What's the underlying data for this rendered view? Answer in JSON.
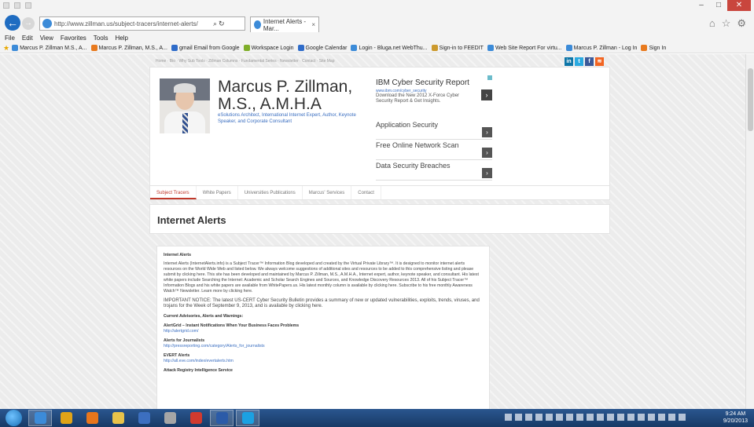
{
  "browser": {
    "url": "http://www.zillman.us/subject-tracers/internet-alerts/",
    "tab_title": "Internet Alerts - Mar...",
    "menu": [
      "File",
      "Edit",
      "View",
      "Favorites",
      "Tools",
      "Help"
    ],
    "favorites": [
      {
        "label": "Marcus P. Zillman M.S., A...",
        "color": "#3c8bd8"
      },
      {
        "label": "Marcus P. Zillman, M.S., A...",
        "color": "#e87a1e"
      },
      {
        "label": "gmail Email from Google",
        "color": "#2f6cc9"
      },
      {
        "label": "Workspace Login",
        "color": "#7fae2a"
      },
      {
        "label": "Google Calendar",
        "color": "#2f6cc9"
      },
      {
        "label": "Login - Bluga.net WebThu...",
        "color": "#3c8bd8"
      },
      {
        "label": "Sign-in to FEEDIT",
        "color": "#cc9a2e"
      },
      {
        "label": "Web Site Report For virtu...",
        "color": "#3c8bd8"
      },
      {
        "label": "Marcus P. Zillman - Log In",
        "color": "#3c8bd8"
      },
      {
        "label": "Sign In",
        "color": "#e87a1e"
      }
    ]
  },
  "site": {
    "topnav": "Home · Bio · Why Sub Tools · Zillman Columns · Fundamental Series · Newsletter · Contact · Site Map",
    "name_line1": "Marcus P. Zillman,",
    "name_line2": "M.S., A.M.H.A",
    "tagline_prefix": "eSolutions Architect, International Internet Expert, Author, Keynote Speaker, and Corporate Consultant",
    "ad": {
      "title": "IBM Cyber Security Report",
      "url": "www.ibm.com/cyber_security",
      "desc": "Download the New 2012 X-Force Cyber Security Report & Get Insights."
    },
    "ad_links": [
      "Application Security",
      "Free Online Network Scan",
      "Data Security Breaches"
    ],
    "subnav": [
      "Subject Tracers",
      "White Papers",
      "Universities Publications",
      "Marcus' Services",
      "Contact"
    ],
    "page_title": "Internet Alerts",
    "content": {
      "heading": "Internet Alerts",
      "intro": "Internet Alerts (InternetAlerts.info) is a Subject Tracer™ Information Blog developed and created by the Virtual Private Library™. It is designed to monitor internet alerts resources on the World Wide Web and listed below. We always welcome suggestions of additional sites and resources to be added to this comprehensive listing and please submit by clicking here. This site has been developed and maintained by Marcus P. Zillman, M.S., A.M.H.A., Internet expert, author, keynote speaker, and consultant. His latest white papers include Searching the Internet: Academic and Scholar Search Engines and Sources, and Knowledge Discovery Resources 2013. All of his Subject Tracer™ Information Blogs and his white papers are available from WhitePapers.us. His latest monthly column is available by clicking here. Subscribe to his free monthly Awareness Watch™ Newsletter. Learn more by clicking here.",
      "notice": "IMPORTANT NOTICE: The latest US-CERT Cyber Security Bulletin provides a summary of new or updated vulnerabilities, exploits, trends, viruses, and trojans for the Week of September 9, 2013, and is available by clicking here.",
      "section": "Current Advisories, Alerts and Warnings:",
      "items": [
        {
          "title": "AlertGrid – Instant Notifications When Your Business Faces Problems",
          "link": "http://alertgrid.com/"
        },
        {
          "title": "Alerts for Journalists",
          "link": "http://pressreporting.com/category/Alerts_for_journalists"
        },
        {
          "title": "EVERT Alerts",
          "link": "http://all.eve.com/index/evertalerts.htm"
        },
        {
          "title": "Attack Registry Intelligence Service",
          "link": ""
        }
      ]
    }
  },
  "taskbar": {
    "time": "9:24 AM",
    "date": "9/20/2013",
    "apps": [
      {
        "name": "ie",
        "color": "#3c8bd8",
        "active": true
      },
      {
        "name": "chrome",
        "color": "#e0a418",
        "active": false
      },
      {
        "name": "firefox",
        "color": "#e8761c",
        "active": false
      },
      {
        "name": "explorer",
        "color": "#e8c34a",
        "active": false
      },
      {
        "name": "media",
        "color": "#3c6fc0",
        "active": false
      },
      {
        "name": "settings",
        "color": "#a6a6a6",
        "active": false
      },
      {
        "name": "opera",
        "color": "#d23a2e",
        "active": false
      },
      {
        "name": "word",
        "color": "#2b5ba8",
        "active": true
      },
      {
        "name": "skype",
        "color": "#1ba1e2",
        "active": true
      }
    ]
  }
}
